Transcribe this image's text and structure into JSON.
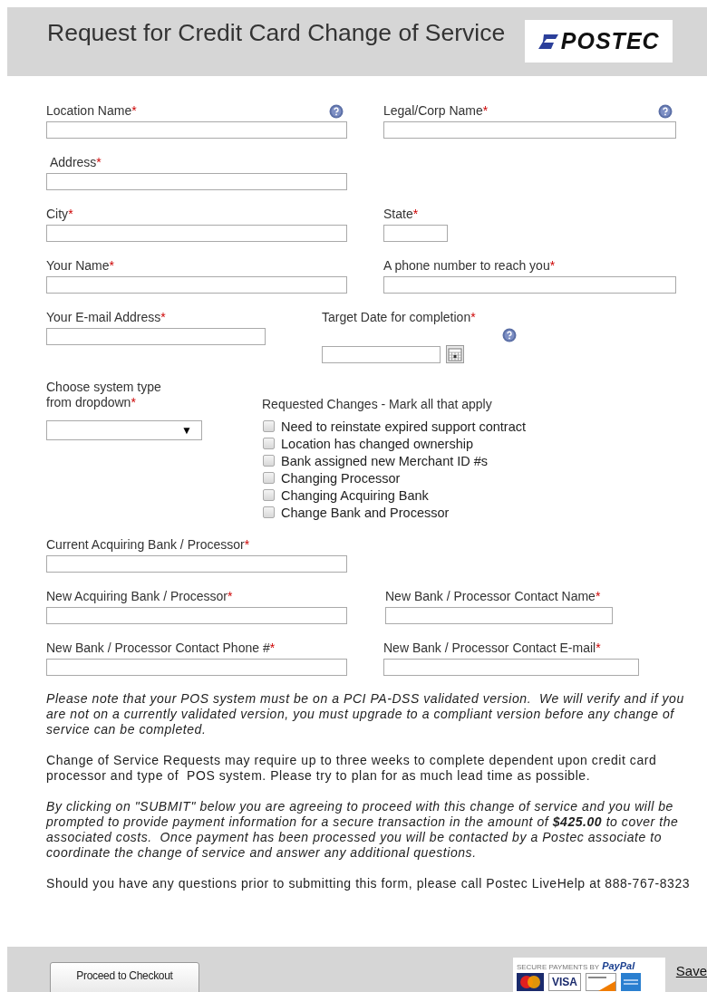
{
  "header": {
    "title": "Request for Credit Card Change of Service",
    "logo": "POSTEC"
  },
  "rows": [
    [
      {
        "kind": "text",
        "label": "Location Name",
        "mark": "*",
        "help": true
      },
      {
        "kind": "text",
        "label": "Legal/Corp Name",
        "mark": "*",
        "help": true
      }
    ],
    [
      {
        "kind": "text",
        "label": "Address",
        "mark": "*"
      }
    ],
    [
      {
        "kind": "text",
        "label": "City",
        "mark": "*"
      },
      {
        "kind": "text",
        "label": "State",
        "mark": "*"
      }
    ],
    [
      {
        "kind": "text",
        "label": "Your Name",
        "mark": "*"
      },
      {
        "kind": "text",
        "label": "A phone number to reach you",
        "mark": "*"
      }
    ],
    [
      {
        "kind": "text",
        "label": "Your E-mail Address",
        "mark": "*"
      },
      {
        "kind": "date",
        "label": "Target Date for completion",
        "mark": "*",
        "help": true
      }
    ],
    [
      {
        "kind": "select",
        "label": "Choose system type from dropdown",
        "mark": "*",
        "arrow": "▼"
      },
      {
        "kind": "checklist",
        "label": "Requested Changes - Mark all that apply",
        "items": [
          {
            "label": "Need to reinstate expired support contract",
            "checked": false
          },
          {
            "label": "Location has changed ownership",
            "checked": false
          },
          {
            "label": "Bank assigned new Merchant ID #s",
            "checked": false
          },
          {
            "label": "Changing Processor",
            "checked": false
          },
          {
            "label": "Changing Acquiring Bank",
            "checked": false
          },
          {
            "label": "Change Bank and Processor",
            "checked": false
          }
        ]
      }
    ],
    [
      {
        "kind": "text",
        "label": "Current Acquiring Bank / Processor",
        "mark": "*"
      }
    ],
    [
      {
        "kind": "text",
        "label": "New Acquiring Bank / Processor",
        "mark": "*"
      },
      {
        "kind": "text",
        "label": "New Bank / Processor Contact Name",
        "mark": "*"
      }
    ],
    [
      {
        "kind": "text",
        "label": "New Bank / Processor Contact Phone #",
        "mark": "*"
      },
      {
        "kind": "text",
        "label": "New Bank / Processor Contact E-mail",
        "mark": "*"
      }
    ]
  ],
  "notes": [
    {
      "text": "Please note that your POS system must be on a PCI PA-DSS validated version.  We will verify and if you are not on a currently validated version, you must upgrade to a compliant version before any change of service can be completed.",
      "italic": true
    },
    {
      "text": "Change of Service Requests may require up to three weeks to complete dependent upon credit card processor and type of  POS system. Please try to plan for as much lead time as possible.",
      "italic": false
    },
    {
      "text": "By clicking on \"SUBMIT\" below you are agreeing to proceed with this change of service and you will be prompted to provide payment information for a secure transaction in the amount of **$425.00** to cover the associated costs.  Once payment has been processed you will be contacted by a Postec associate to coordinate the change of service and answer any additional questions.",
      "italic": true
    },
    {
      "text": "Should you have any questions prior to submitting this form, please call Postec LiveHelp at 888-767-8323",
      "italic": false
    }
  ],
  "footer": {
    "button": "Proceed to Checkout",
    "badge": {
      "caption": "SECURE PAYMENTS BY",
      "brand": "PayPal",
      "card": "VISA"
    },
    "link": "Save"
  }
}
